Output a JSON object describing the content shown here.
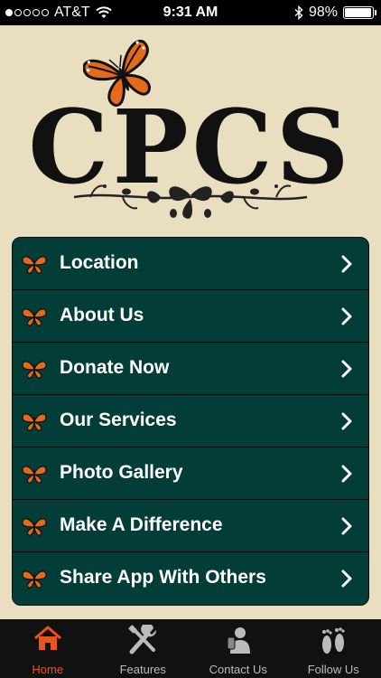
{
  "status_bar": {
    "carrier": "AT&T",
    "time": "9:31 AM",
    "battery": "98%",
    "battery_level": 0.98,
    "signal_bars": 1
  },
  "header": {
    "logo_text": "CPCS"
  },
  "menu": {
    "items": [
      {
        "label": "Location",
        "icon": "butterfly-icon"
      },
      {
        "label": "About Us",
        "icon": "butterfly-icon"
      },
      {
        "label": "Donate Now",
        "icon": "butterfly-icon"
      },
      {
        "label": "Our Services",
        "icon": "butterfly-icon"
      },
      {
        "label": "Photo Gallery",
        "icon": "butterfly-icon"
      },
      {
        "label": "Make A Difference",
        "icon": "butterfly-icon"
      },
      {
        "label": "Share App With Others",
        "icon": "butterfly-icon"
      }
    ]
  },
  "tab_bar": {
    "tabs": [
      {
        "label": "Home",
        "icon": "home-icon",
        "active": true
      },
      {
        "label": "Features",
        "icon": "tools-icon",
        "active": false
      },
      {
        "label": "Contact Us",
        "icon": "contact-person-icon",
        "active": false
      },
      {
        "label": "Follow Us",
        "icon": "footprints-icon",
        "active": false
      }
    ]
  },
  "colors": {
    "background": "#e9dec0",
    "menu_background": "#023d37",
    "accent": "#e8541c",
    "tab_bar_background": "#111111"
  }
}
